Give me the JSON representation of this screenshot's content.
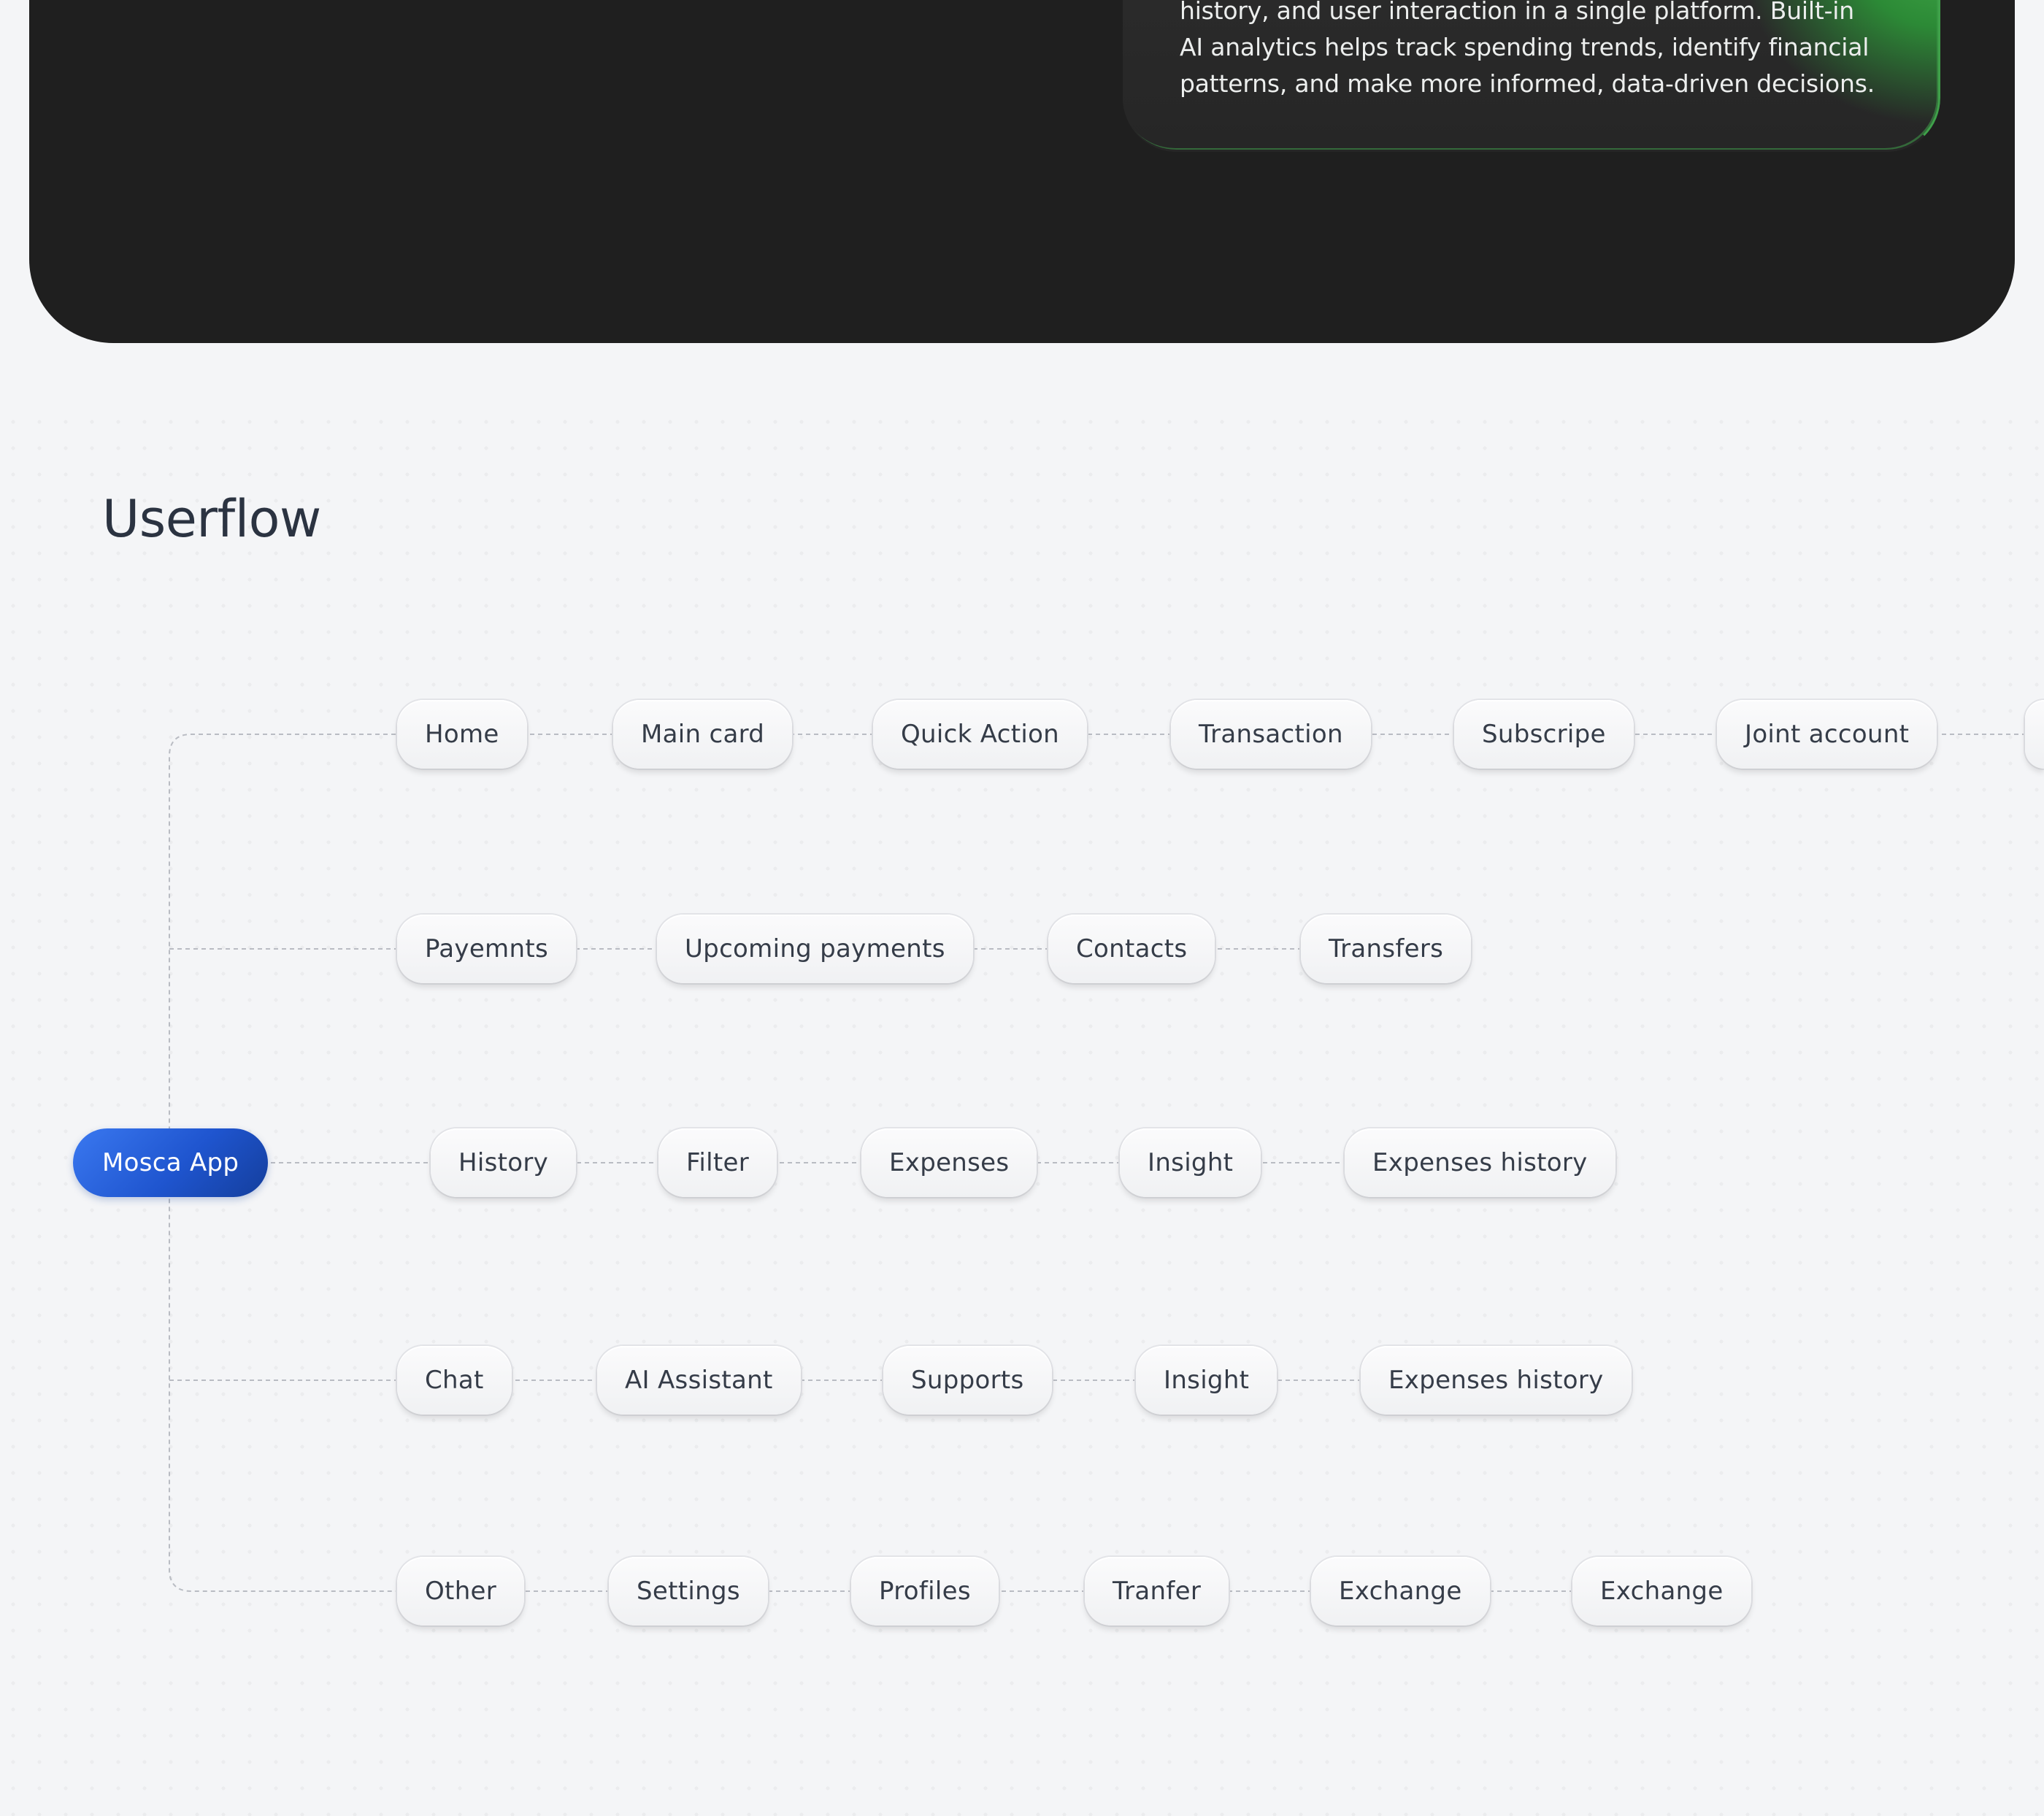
{
  "hero": {
    "description": "created, bringing together fund management, transaction history, and user interaction in a single platform. Built-in AI analytics helps track spending trends, identify financial patterns, and make more informed, data-driven decisions."
  },
  "userflow": {
    "title": "Userflow",
    "root": "Mosca App",
    "branches": [
      {
        "id": "home",
        "nodes": [
          "Home",
          "Main card",
          "Quick Action",
          "Transaction",
          "Subscripe",
          "Joint account",
          ""
        ]
      },
      {
        "id": "payments",
        "nodes": [
          "Payemnts",
          "Upcoming payments",
          "Contacts",
          "Transfers"
        ]
      },
      {
        "id": "history",
        "nodes": [
          "History",
          "Filter",
          "Expenses",
          "Insight",
          "Expenses history"
        ]
      },
      {
        "id": "chat",
        "nodes": [
          "Chat",
          "AI Assistant",
          "Supports",
          "Insight",
          "Expenses history"
        ]
      },
      {
        "id": "other",
        "nodes": [
          "Other",
          "Settings",
          "Profiles",
          "Tranfer",
          "Exchange",
          "Exchange"
        ]
      }
    ]
  },
  "colors": {
    "page_bg": "#f4f5f7",
    "dark_panel": "#1f1f1f",
    "accent_green": "#3ea346",
    "root_blue": "#1f55cf",
    "connector": "#b9bcc3"
  }
}
